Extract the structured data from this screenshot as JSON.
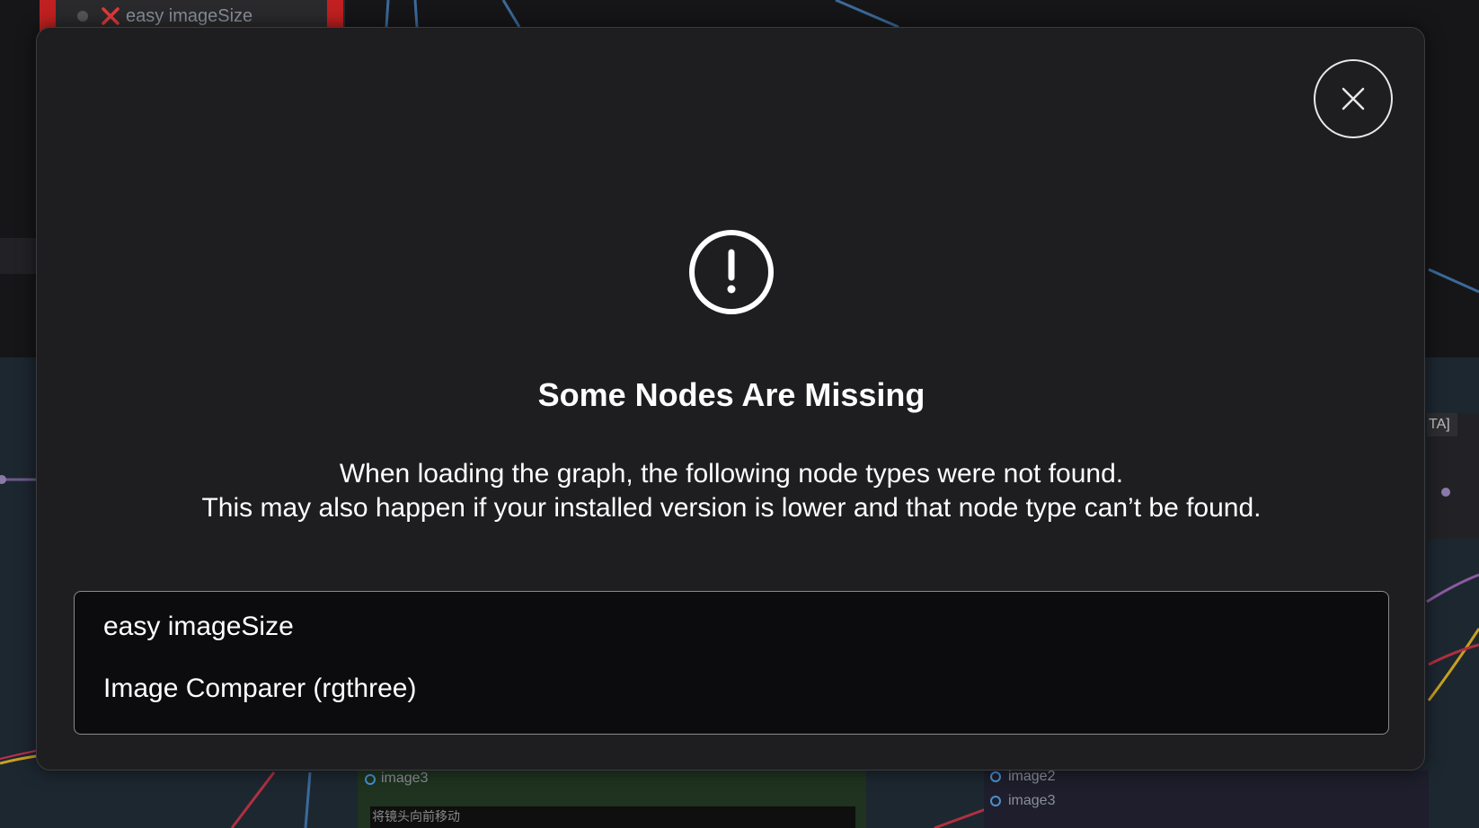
{
  "background": {
    "top_node_title": "easy imageSize",
    "node_slots_left": [
      "image3"
    ],
    "node_slots_right": [
      "image2",
      "image3"
    ],
    "node_text_field": "将镜头向前移动",
    "right_partial_label": "TA]"
  },
  "dialog": {
    "icon": "exclamation-circle-icon",
    "close_icon": "close-x-icon",
    "title": "Some Nodes Are Missing",
    "description_lines": [
      "When loading the graph, the following node types were not found.",
      "This may also happen if your installed version is lower and that node type can’t be found."
    ],
    "missing_nodes": [
      "easy imageSize",
      "Image Comparer (rgthree)"
    ]
  },
  "colors": {
    "accent_error": "#e03a3a",
    "dialog_bg": "#1e1e20",
    "list_bg": "#0c0c0e"
  }
}
